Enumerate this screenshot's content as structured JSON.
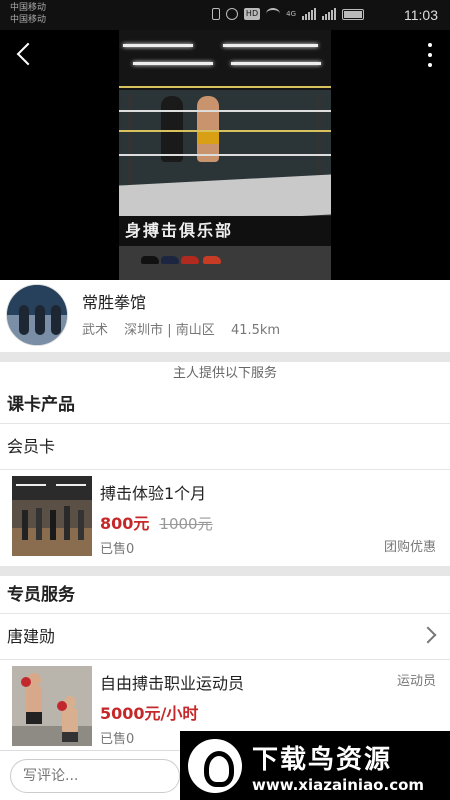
{
  "status_bar": {
    "carrier_1": "中国移动",
    "carrier_2": "中国移动",
    "network_badge": "HD",
    "signal_label": "4G",
    "time": "11:03"
  },
  "video": {
    "banner_text": "身搏击俱乐部"
  },
  "gym": {
    "name": "常胜拳馆",
    "category": "武术",
    "location": "深圳市 | 南山区",
    "distance": "41.5km"
  },
  "services_caption": "主人提供以下服务",
  "course_section": {
    "title": "课卡产品",
    "row_label": "会员卡",
    "product": {
      "title": "搏击体验1个月",
      "price": "800元",
      "old_price": "1000元",
      "sold": "已售0",
      "tag": "团购优惠"
    }
  },
  "staff_section": {
    "title": "专员服务",
    "row_label": "唐建勋",
    "product": {
      "title": "自由搏击职业运动员",
      "price": "5000元/小时",
      "sold": "已售0",
      "tag": "运动员"
    }
  },
  "bottom_bar": {
    "comment_placeholder": "写评论..."
  },
  "watermark": {
    "title": "下载鸟资源",
    "url": "www.xiazainiao.com"
  },
  "colors": {
    "price_red": "#c6282a",
    "background": "#f0f0f0"
  }
}
